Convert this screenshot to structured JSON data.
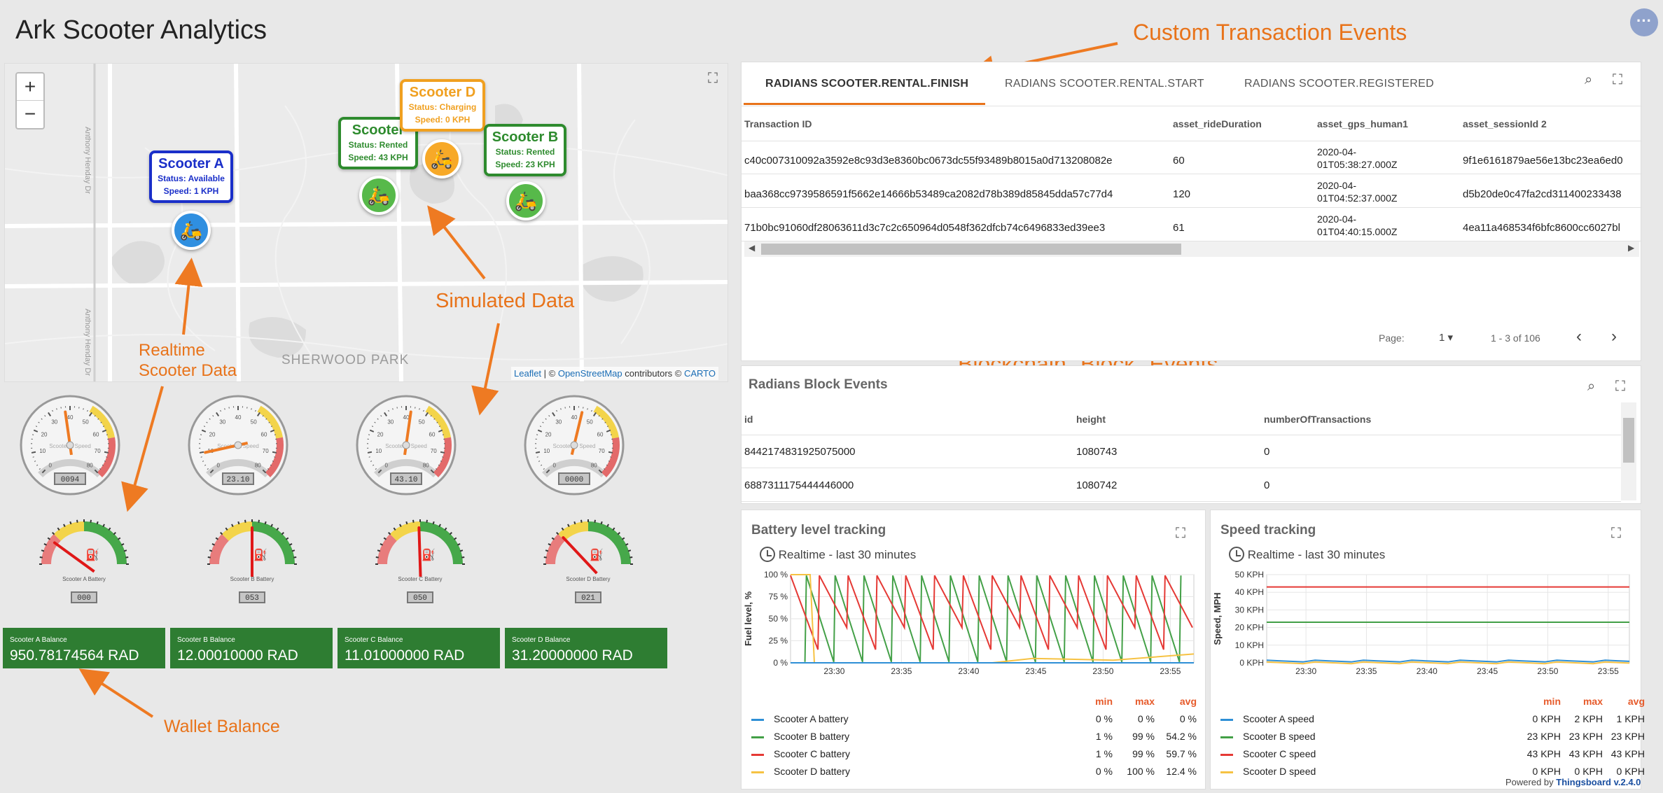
{
  "app": {
    "title": "Ark Scooter Analytics",
    "menu_icon": "more-horiz-icon",
    "footer": "Powered by Thingsboard v.2.4.0",
    "footer_prefix": "Powered by ",
    "footer_brand": "Thingsboard v.2.4.0"
  },
  "map": {
    "zoom_in": "+",
    "zoom_out": "−",
    "attribution_leaflet": "Leaflet",
    "attribution_mid": " | © ",
    "attribution_osm": "OpenStreetMap",
    "attribution_tail": " contributors © ",
    "attribution_carto": "CARTO",
    "place_label": "SHERWOOD PARK",
    "road_1": "Anthony Henday Dr",
    "road_2": "Anthony Henday Dr",
    "markers": [
      {
        "name": "Scooter A",
        "status": "Status: Available",
        "speed": "Speed: 1 KPH",
        "color": "#1a2fc9",
        "pin_color": "#2f8fe0"
      },
      {
        "name": "Scooter",
        "status": "Status: Rented",
        "speed": "Speed: 43 KPH",
        "color": "#2e8b2e",
        "pin_color": "#57b94a"
      },
      {
        "name": "Scooter D",
        "status": "Status: Charging",
        "speed": "Speed: 0 KPH",
        "color": "#f0a020",
        "pin_color": "#f7a928"
      },
      {
        "name": "Scooter B",
        "status": "Status: Rented",
        "speed": "Speed: 23 KPH",
        "color": "#2e8b2e",
        "pin_color": "#57b94a"
      }
    ]
  },
  "annotations": {
    "custom_tx": "Custom Transaction Events",
    "simulated": "Simulated Data",
    "realtime_1": "Realtime",
    "realtime_2": "Scooter Data",
    "blockchain": "Blockchain \"Block\" Events",
    "wallet": "Wallet Balance"
  },
  "transactions": {
    "tabs": [
      "RADIANS SCOOTER.RENTAL.FINISH",
      "RADIANS SCOOTER.RENTAL.START",
      "RADIANS SCOOTER.REGISTERED"
    ],
    "columns": [
      "Transaction ID",
      "asset_rideDuration",
      "asset_gps_human1",
      "asset_sessionId 2"
    ],
    "rows": [
      [
        "c40c007310092a3592e8c93d3e8360bc0673dc55f93489b8015a0d713208082e",
        "60",
        "2020-04-",
        "01T05:38:27.000Z",
        "9f1e6161879ae56e13bc23ea6ed0"
      ],
      [
        "baa368cc9739586591f5662e14666b53489ca2082d78b389d85845dda57c77d4",
        "120",
        "2020-04-",
        "01T04:52:37.000Z",
        "d5b20de0c47fa2cd311400233438"
      ],
      [
        "71b0bc91060df28063611d3c7c2c650964d0548f362dfcb74c6496833ed39ee3",
        "61",
        "2020-04-",
        "01T04:40:15.000Z",
        "4ea11a468534f6bfc8600cc6027bl"
      ]
    ],
    "page_label": "Page:",
    "page_value": "1",
    "range": "1 - 3 of 106"
  },
  "blocks": {
    "title": "Radians Block Events",
    "columns": [
      "id",
      "height",
      "numberOfTransactions"
    ],
    "rows": [
      [
        "8442174831925075000",
        "1080743",
        "0"
      ],
      [
        "6887311175444446000",
        "1080742",
        "0"
      ]
    ]
  },
  "speed_gauges": [
    {
      "label": "Scooter A Speed",
      "value": "0094",
      "frac": 0.47
    },
    {
      "label": "Scooter A Speed",
      "value": "23.10",
      "frac": 0.12
    },
    {
      "label": "Scooter A Speed",
      "value": "43.10",
      "frac": 0.53
    },
    {
      "label": "Scooter D Speed",
      "value": "0000",
      "frac": 0.55
    }
  ],
  "battery_gauges": [
    {
      "label": "Scooter A Battery",
      "value": "000",
      "frac": 0.2
    },
    {
      "label": "Scooter B Battery",
      "value": "053",
      "frac": 0.5
    },
    {
      "label": "Scooter C Battery",
      "value": "050",
      "frac": 0.49
    },
    {
      "label": "Scooter D Battery",
      "value": "021",
      "frac": 0.26
    }
  ],
  "speed_gauge_ticks": [
    "0",
    "10",
    "20",
    "30",
    "40",
    "50",
    "60",
    "70",
    "80"
  ],
  "wallets": [
    {
      "label": "Scooter A Balance",
      "value": "950.78174564 RAD"
    },
    {
      "label": "Scooter B Balance",
      "value": "12.00010000 RAD"
    },
    {
      "label": "Scooter C Balance",
      "value": "11.01000000 RAD"
    },
    {
      "label": "Scooter D Balance",
      "value": "31.20000000 RAD"
    }
  ],
  "colors": {
    "s1": "#2e8fd6",
    "s2": "#43a047",
    "s3": "#e53935",
    "s4": "#f6c243",
    "accent": "#e8731a",
    "wallet": "#2e7d32"
  },
  "battery_chart": {
    "title": "Battery level tracking",
    "timewindow": "Realtime - last 30 minutes",
    "stats_header": [
      "min",
      "max",
      "avg"
    ],
    "chart_data": {
      "type": "line",
      "ylabel": "Fuel level, %",
      "y_ticks": [
        "0 %",
        "25 %",
        "50 %",
        "75 %",
        "100 %"
      ],
      "x_ticks": [
        "23:30",
        "23:35",
        "23:40",
        "23:45",
        "23:50",
        "23:55"
      ],
      "ylim": [
        0,
        100
      ],
      "series": [
        {
          "name": "Scooter A battery",
          "min": "0 %",
          "max": "0 %",
          "avg": "0 %"
        },
        {
          "name": "Scooter B battery",
          "min": "1 %",
          "max": "99 %",
          "avg": "54.2 %"
        },
        {
          "name": "Scooter C battery",
          "min": "1 %",
          "max": "99 %",
          "avg": "59.7 %"
        },
        {
          "name": "Scooter D battery",
          "min": "0 %",
          "max": "100 %",
          "avg": "12.4 %"
        }
      ]
    }
  },
  "speed_chart": {
    "title": "Speed tracking",
    "timewindow": "Realtime - last 30 minutes",
    "stats_header": [
      "min",
      "max",
      "avg"
    ],
    "chart_data": {
      "type": "line",
      "ylabel": "Speed, MPH",
      "y_ticks": [
        "0 KPH",
        "10 KPH",
        "20 KPH",
        "30 KPH",
        "40 KPH",
        "50 KPH"
      ],
      "x_ticks": [
        "23:30",
        "23:35",
        "23:40",
        "23:45",
        "23:50",
        "23:55"
      ],
      "ylim": [
        0,
        50
      ],
      "series": [
        {
          "name": "Scooter A speed",
          "min": "0 KPH",
          "max": "2 KPH",
          "avg": "1 KPH",
          "level": 1
        },
        {
          "name": "Scooter B speed",
          "min": "23 KPH",
          "max": "23 KPH",
          "avg": "23 KPH",
          "level": 23
        },
        {
          "name": "Scooter C speed",
          "min": "43 KPH",
          "max": "43 KPH",
          "avg": "43 KPH",
          "level": 43
        },
        {
          "name": "Scooter D speed",
          "min": "0 KPH",
          "max": "0 KPH",
          "avg": "0 KPH",
          "level": 0
        }
      ]
    }
  }
}
